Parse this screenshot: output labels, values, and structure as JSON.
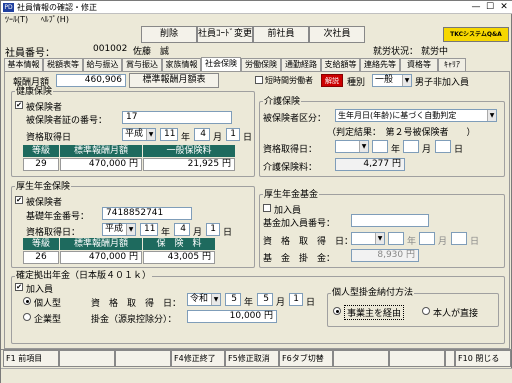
{
  "window": {
    "title": "社員情報の確認・修正",
    "icon": "PD"
  },
  "menu": [
    "ﾂｰﾙ(T)",
    "ﾍﾙﾌﾟ(H)"
  ],
  "toolbar": {
    "delete": "削除",
    "code_change": "社員ｺｰﾄﾞ変更",
    "prev": "前社員",
    "next": "次社員",
    "logo": "TKCシステムQ&A"
  },
  "employee": {
    "label": "社員番号：",
    "number": "001002",
    "name": "佐藤　誠",
    "status_label": "就労状況：",
    "status_value": "就労中"
  },
  "tabs": [
    "基本情報",
    "税額表等",
    "給与振込",
    "賞与振込",
    "家族情報",
    "社会保険",
    "労働保険",
    "通勤経路",
    "支給額等",
    "連絡先等",
    "資格等",
    "ｷｬﾘｱ"
  ],
  "active_tab": 5,
  "top_row": {
    "monthly_label": "報酬月額",
    "monthly_value": "460,906",
    "std_table_button": "標準報酬月額表",
    "short_time_label": "短時間労働者",
    "release_button": "解説",
    "type_label": "種別",
    "type_value": "一般",
    "type_desc": "男子非加入員"
  },
  "health": {
    "title": "健康保険",
    "insured_label": "被保険者",
    "insured_checked": true,
    "cert_label": "被保険者証の番号：",
    "cert_value": "17",
    "date_label": "資格取得日",
    "era": "平成",
    "year": "11",
    "month": "4",
    "day": "1",
    "y": "年",
    "m": "月",
    "d": "日",
    "headers": [
      "等級",
      "標準報酬月額",
      "一般保険料"
    ],
    "row": [
      "29",
      "470,000 円",
      "21,925 円"
    ]
  },
  "care": {
    "title": "介護保険",
    "class_label": "被保険者区分：",
    "class_value": "生年月日(年齢)に基づく自動判定",
    "result": "（判定結果：　第２号被保険者　　）",
    "date_label": "資格取得日：",
    "y": "年",
    "m": "月",
    "d": "日",
    "premium_label": "介護保険料：",
    "premium_value": "4,277 円"
  },
  "pension": {
    "title": "厚生年金保険",
    "insured_label": "被保険者",
    "insured_checked": true,
    "base_label": "基礎年金番号：",
    "base_value": "7418852741",
    "date_label": "資格取得日：",
    "era": "平成",
    "year": "11",
    "month": "4",
    "day": "1",
    "y": "年",
    "m": "月",
    "d": "日",
    "headers": [
      "等級",
      "標準報酬月額",
      "保　険　料"
    ],
    "row": [
      "26",
      "470,000 円",
      "43,005 円"
    ]
  },
  "fund": {
    "title": "厚生年金基金",
    "member_label": "加入員",
    "member_checked": false,
    "number_label": "基金加入員番号：",
    "date_label": "資　格　取　得　日：",
    "y": "年",
    "m": "月",
    "d": "日",
    "fee_label": "基　金　掛　金：",
    "fee_value": "8,930 円"
  },
  "dc": {
    "title": "確定拠出年金（日本版４０１ｋ）",
    "member_label": "加入員",
    "member_checked": true,
    "individual": "個人型",
    "corporate": "企業型",
    "selected": "individual",
    "date_label": "資　格　取　得　日：",
    "era": "令和",
    "year": "5",
    "month": "5",
    "day": "1",
    "y": "年",
    "m": "月",
    "d": "日",
    "fee_label": "掛金（源泉控除分）：",
    "fee_value": "10,000 円",
    "method_title": "個人型掛金納付方法",
    "method_employer": "事業主を経由",
    "method_self": "本人が直接",
    "method_selected": "employer"
  },
  "fkeys": {
    "f1": "F1 前項目",
    "f4": "F4修正終了",
    "f5": "F5修正取消",
    "f6": "F6タブ切替",
    "f10": "F10 閉じる"
  }
}
